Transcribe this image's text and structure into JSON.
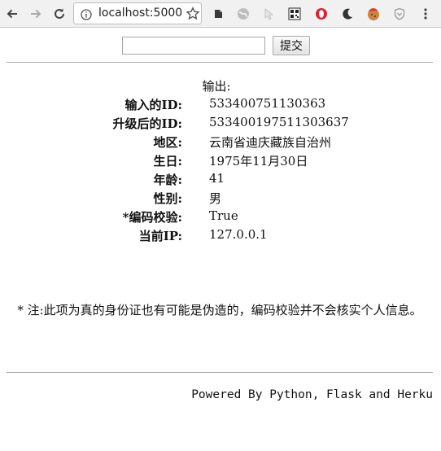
{
  "browser": {
    "url": "localhost:5000"
  },
  "form": {
    "input_value": "",
    "submit_label": "提交"
  },
  "output": {
    "title": "输出:",
    "rows": [
      {
        "label": "输入的ID:",
        "value": "533400751130363"
      },
      {
        "label": "升级后的ID:",
        "value": "533400197511303637"
      },
      {
        "label": "地区:",
        "value": "云南省迪庆藏族自治州"
      },
      {
        "label": "生日:",
        "value": "1975年11月30日"
      },
      {
        "label": "年龄:",
        "value": "41"
      },
      {
        "label": "性别:",
        "value": "男"
      },
      {
        "label": "*编码校验:",
        "value": "True"
      },
      {
        "label": "当前IP:",
        "value": "127.0.0.1"
      }
    ]
  },
  "note": "* 注:此项为真的身份证也有可能是伪造的，编码校验并不会核实个人信息。",
  "footer": "Powered By Python, Flask and Herku"
}
